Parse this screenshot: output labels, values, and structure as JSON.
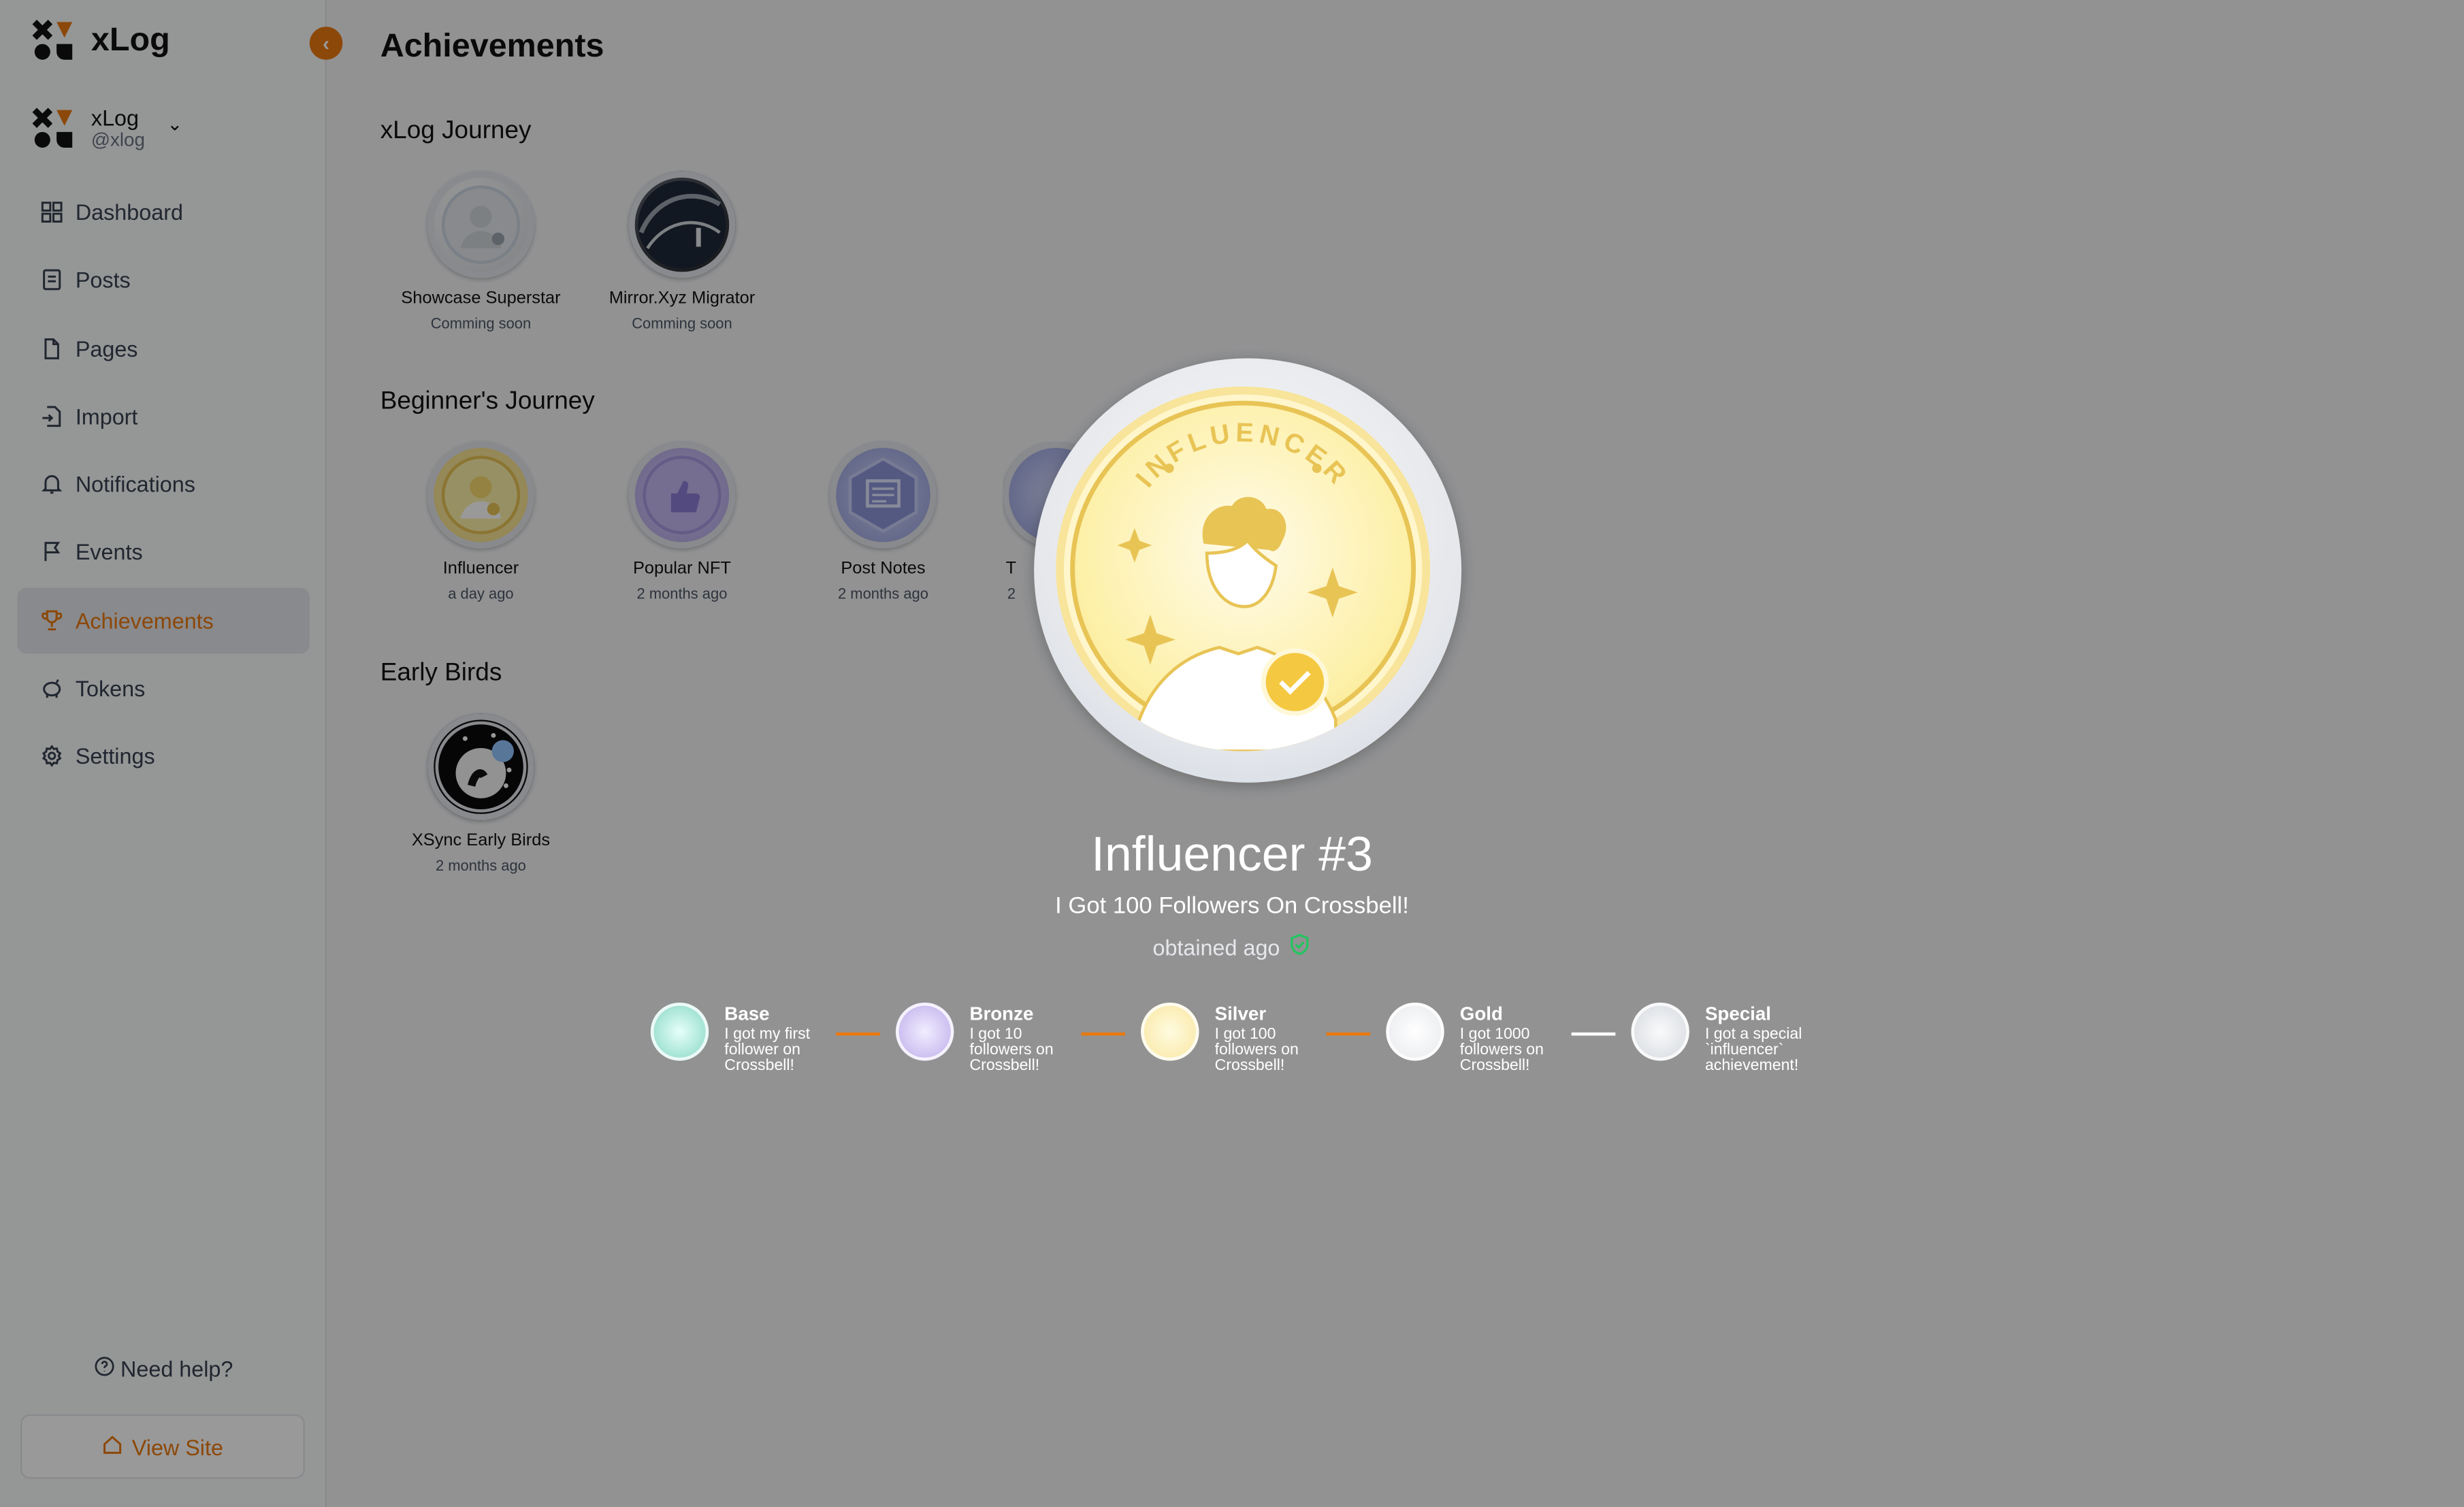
{
  "app": {
    "name": "xLog",
    "account_name": "xLog",
    "account_handle": "@xlog"
  },
  "sidebar": {
    "items": [
      {
        "label": "Dashboard",
        "icon": "grid-icon"
      },
      {
        "label": "Posts",
        "icon": "document-icon"
      },
      {
        "label": "Pages",
        "icon": "page-icon"
      },
      {
        "label": "Import",
        "icon": "import-icon"
      },
      {
        "label": "Notifications",
        "icon": "bell-icon"
      },
      {
        "label": "Events",
        "icon": "flag-icon"
      },
      {
        "label": "Achievements",
        "icon": "trophy-icon",
        "active": true
      },
      {
        "label": "Tokens",
        "icon": "piggy-bank-icon"
      },
      {
        "label": "Settings",
        "icon": "gear-icon"
      }
    ],
    "help_label": "Need help?",
    "view_site_label": "View Site"
  },
  "main": {
    "title": "Achievements",
    "sections": [
      {
        "title": "xLog Journey",
        "badges": [
          {
            "name": "Showcase Superstar",
            "sub": "Comming soon"
          },
          {
            "name": "Mirror.Xyz Migrator",
            "sub": "Comming soon"
          }
        ]
      },
      {
        "title": "Beginner's Journey",
        "badges": [
          {
            "name": "Influencer",
            "sub": "a day ago"
          },
          {
            "name": "Popular NFT",
            "sub": "2 months ago"
          },
          {
            "name": "Post Notes",
            "sub": "2 months ago"
          },
          {
            "name": "T",
            "sub": "2"
          }
        ]
      },
      {
        "title": "Early Birds",
        "badges": [
          {
            "name": "XSync Early Birds",
            "sub": "2 months ago"
          }
        ]
      }
    ]
  },
  "modal": {
    "badge_text": "INFLUENCER",
    "title": "Influencer #3",
    "description": "I Got 100 Followers On Crossbell!",
    "obtained": "obtained ago",
    "tiers": [
      {
        "name": "Base",
        "desc": "I got my first follower on Crossbell!",
        "color": "#7dd3c0"
      },
      {
        "name": "Bronze",
        "desc": "I got 10 followers on Crossbell!",
        "color": "#b8a6e8"
      },
      {
        "name": "Silver",
        "desc": "I got 100 followers on Crossbell!",
        "color": "#f8e49a"
      },
      {
        "name": "Gold",
        "desc": "I got 1000 followers on Crossbell!",
        "color": "#e5e7eb"
      },
      {
        "name": "Special",
        "desc": "I got a special `influencer` achievement!",
        "color": "#d1d5db"
      }
    ]
  },
  "colors": {
    "accent": "#e9780f",
    "overlay": "rgba(0,0,0,0.4)"
  }
}
